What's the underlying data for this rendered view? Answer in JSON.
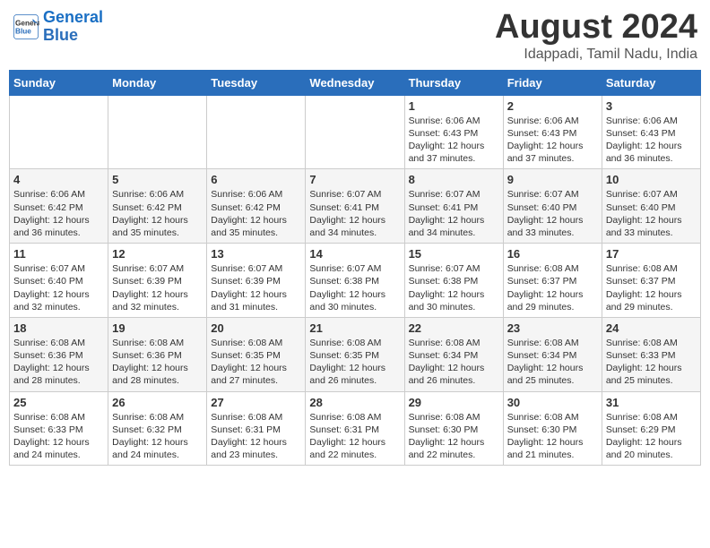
{
  "header": {
    "logo_line1": "General",
    "logo_line2": "Blue",
    "month": "August 2024",
    "location": "Idappadi, Tamil Nadu, India"
  },
  "weekdays": [
    "Sunday",
    "Monday",
    "Tuesday",
    "Wednesday",
    "Thursday",
    "Friday",
    "Saturday"
  ],
  "weeks": [
    [
      {
        "day": "",
        "info": ""
      },
      {
        "day": "",
        "info": ""
      },
      {
        "day": "",
        "info": ""
      },
      {
        "day": "",
        "info": ""
      },
      {
        "day": "1",
        "info": "Sunrise: 6:06 AM\nSunset: 6:43 PM\nDaylight: 12 hours\nand 37 minutes."
      },
      {
        "day": "2",
        "info": "Sunrise: 6:06 AM\nSunset: 6:43 PM\nDaylight: 12 hours\nand 37 minutes."
      },
      {
        "day": "3",
        "info": "Sunrise: 6:06 AM\nSunset: 6:43 PM\nDaylight: 12 hours\nand 36 minutes."
      }
    ],
    [
      {
        "day": "4",
        "info": "Sunrise: 6:06 AM\nSunset: 6:42 PM\nDaylight: 12 hours\nand 36 minutes."
      },
      {
        "day": "5",
        "info": "Sunrise: 6:06 AM\nSunset: 6:42 PM\nDaylight: 12 hours\nand 35 minutes."
      },
      {
        "day": "6",
        "info": "Sunrise: 6:06 AM\nSunset: 6:42 PM\nDaylight: 12 hours\nand 35 minutes."
      },
      {
        "day": "7",
        "info": "Sunrise: 6:07 AM\nSunset: 6:41 PM\nDaylight: 12 hours\nand 34 minutes."
      },
      {
        "day": "8",
        "info": "Sunrise: 6:07 AM\nSunset: 6:41 PM\nDaylight: 12 hours\nand 34 minutes."
      },
      {
        "day": "9",
        "info": "Sunrise: 6:07 AM\nSunset: 6:40 PM\nDaylight: 12 hours\nand 33 minutes."
      },
      {
        "day": "10",
        "info": "Sunrise: 6:07 AM\nSunset: 6:40 PM\nDaylight: 12 hours\nand 33 minutes."
      }
    ],
    [
      {
        "day": "11",
        "info": "Sunrise: 6:07 AM\nSunset: 6:40 PM\nDaylight: 12 hours\nand 32 minutes."
      },
      {
        "day": "12",
        "info": "Sunrise: 6:07 AM\nSunset: 6:39 PM\nDaylight: 12 hours\nand 32 minutes."
      },
      {
        "day": "13",
        "info": "Sunrise: 6:07 AM\nSunset: 6:39 PM\nDaylight: 12 hours\nand 31 minutes."
      },
      {
        "day": "14",
        "info": "Sunrise: 6:07 AM\nSunset: 6:38 PM\nDaylight: 12 hours\nand 30 minutes."
      },
      {
        "day": "15",
        "info": "Sunrise: 6:07 AM\nSunset: 6:38 PM\nDaylight: 12 hours\nand 30 minutes."
      },
      {
        "day": "16",
        "info": "Sunrise: 6:08 AM\nSunset: 6:37 PM\nDaylight: 12 hours\nand 29 minutes."
      },
      {
        "day": "17",
        "info": "Sunrise: 6:08 AM\nSunset: 6:37 PM\nDaylight: 12 hours\nand 29 minutes."
      }
    ],
    [
      {
        "day": "18",
        "info": "Sunrise: 6:08 AM\nSunset: 6:36 PM\nDaylight: 12 hours\nand 28 minutes."
      },
      {
        "day": "19",
        "info": "Sunrise: 6:08 AM\nSunset: 6:36 PM\nDaylight: 12 hours\nand 28 minutes."
      },
      {
        "day": "20",
        "info": "Sunrise: 6:08 AM\nSunset: 6:35 PM\nDaylight: 12 hours\nand 27 minutes."
      },
      {
        "day": "21",
        "info": "Sunrise: 6:08 AM\nSunset: 6:35 PM\nDaylight: 12 hours\nand 26 minutes."
      },
      {
        "day": "22",
        "info": "Sunrise: 6:08 AM\nSunset: 6:34 PM\nDaylight: 12 hours\nand 26 minutes."
      },
      {
        "day": "23",
        "info": "Sunrise: 6:08 AM\nSunset: 6:34 PM\nDaylight: 12 hours\nand 25 minutes."
      },
      {
        "day": "24",
        "info": "Sunrise: 6:08 AM\nSunset: 6:33 PM\nDaylight: 12 hours\nand 25 minutes."
      }
    ],
    [
      {
        "day": "25",
        "info": "Sunrise: 6:08 AM\nSunset: 6:33 PM\nDaylight: 12 hours\nand 24 minutes."
      },
      {
        "day": "26",
        "info": "Sunrise: 6:08 AM\nSunset: 6:32 PM\nDaylight: 12 hours\nand 24 minutes."
      },
      {
        "day": "27",
        "info": "Sunrise: 6:08 AM\nSunset: 6:31 PM\nDaylight: 12 hours\nand 23 minutes."
      },
      {
        "day": "28",
        "info": "Sunrise: 6:08 AM\nSunset: 6:31 PM\nDaylight: 12 hours\nand 22 minutes."
      },
      {
        "day": "29",
        "info": "Sunrise: 6:08 AM\nSunset: 6:30 PM\nDaylight: 12 hours\nand 22 minutes."
      },
      {
        "day": "30",
        "info": "Sunrise: 6:08 AM\nSunset: 6:30 PM\nDaylight: 12 hours\nand 21 minutes."
      },
      {
        "day": "31",
        "info": "Sunrise: 6:08 AM\nSunset: 6:29 PM\nDaylight: 12 hours\nand 20 minutes."
      }
    ]
  ]
}
